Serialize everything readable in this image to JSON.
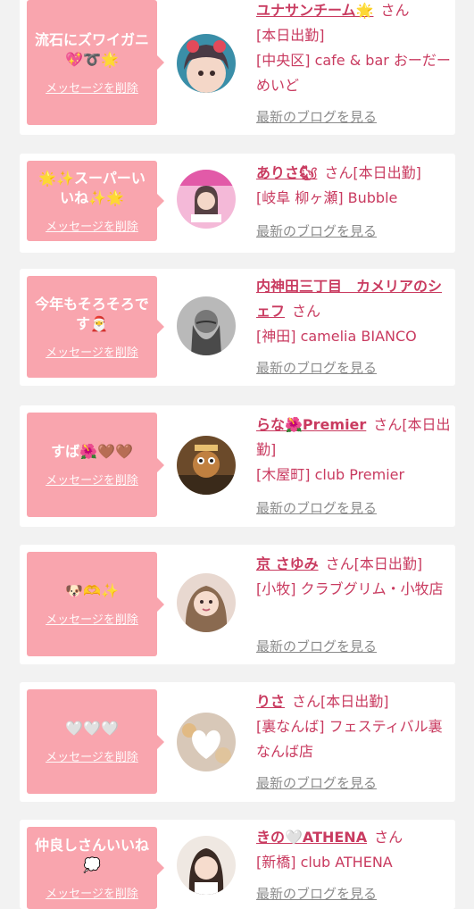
{
  "cards": [
    {
      "message": "流石にズワイガニ\n💖➰🌟",
      "delete_label": "メッセージを削除",
      "name": "ユナサンチーム🌟",
      "honorific": "さん",
      "status": "[本日出勤]",
      "shop": "[中央区] cafe & bar おーだーめいど",
      "blog_label": "最新のブログを見る"
    },
    {
      "message": "🌟✨スーパーい\nいね✨🌟",
      "delete_label": "メッセージを削除",
      "name": "ありさ🐿",
      "honorific": "さん",
      "status": "[本日出勤]",
      "shop": "[岐阜 柳ヶ瀬] Bubble",
      "blog_label": "最新のブログを見る"
    },
    {
      "message": "今年もそろそろで\nす🎅",
      "delete_label": "メッセージを削除",
      "name": "内神田三丁目　カメリアのシェフ",
      "honorific": "さん",
      "status": "",
      "shop": "[神田] camelia BIANCO",
      "blog_label": "最新のブログを見る"
    },
    {
      "message": "すば🌺🤎🤎",
      "delete_label": "メッセージを削除",
      "name": "らな🌺Premier",
      "honorific": "さん",
      "status": "[本日出勤]",
      "shop": "[木屋町] club Premier",
      "blog_label": "最新のブログを見る"
    },
    {
      "message": "🐶🫶✨",
      "delete_label": "メッセージを削除",
      "name": "京 さゆみ",
      "honorific": "さん",
      "status": "[本日出勤]",
      "shop": "[小牧] クラブグリム・小牧店",
      "blog_label": "最新のブログを見る"
    },
    {
      "message": "🤍🤍🤍",
      "delete_label": "メッセージを削除",
      "name": "りさ",
      "honorific": "さん",
      "status": "[本日出勤]",
      "shop": "[裏なんば] フェスティバル裏なんば店",
      "blog_label": "最新のブログを見る"
    },
    {
      "message": "仲良しさんいいね\n💭",
      "delete_label": "メッセージを削除",
      "name": "きの🤍ATHENA",
      "honorific": "さん",
      "status": "",
      "shop": "[新橋] club ATHENA",
      "blog_label": "最新のブログを見る"
    }
  ]
}
